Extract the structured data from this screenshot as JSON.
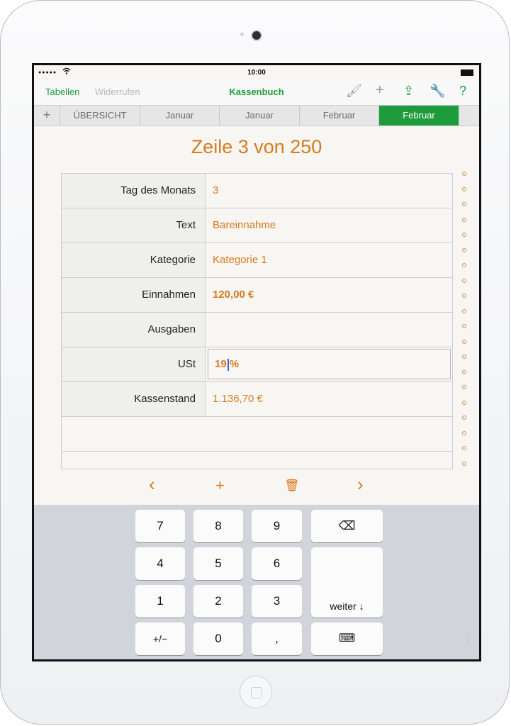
{
  "status_bar": {
    "signal": "●●●●●",
    "time": "10:00"
  },
  "toolbar": {
    "left_label": "Tabellen",
    "undo_label": "Widerrufen",
    "title": "Kassenbuch",
    "icons": [
      "format-brush-icon",
      "add-icon",
      "share-icon",
      "wrench-icon",
      "help-icon"
    ],
    "icon_glyphs": [
      "🖌",
      "+",
      "⇪",
      "🔧",
      "?"
    ]
  },
  "tabs": {
    "add_glyph": "+",
    "items": [
      {
        "label": "ÜBERSICHT",
        "active": false
      },
      {
        "label": "Januar",
        "active": false
      },
      {
        "label": "Januar",
        "active": false
      },
      {
        "label": "Februar",
        "active": false
      },
      {
        "label": "Februar",
        "active": true
      }
    ]
  },
  "form": {
    "title": "Zeile 3 von 250",
    "rows": [
      {
        "label": "Tag des Monats",
        "value": "3"
      },
      {
        "label": "Text",
        "value": "Bareinnahme"
      },
      {
        "label": "Kategorie",
        "value": "Kategorie 1"
      },
      {
        "label": "Einnahmen",
        "value": "120,00 €"
      },
      {
        "label": "Ausgaben",
        "value": ""
      },
      {
        "label": "USt",
        "value_before_caret": "19",
        "value_after_caret": "%"
      },
      {
        "label": "Kassenstand",
        "value": "1.136,70 €"
      }
    ]
  },
  "actions": {
    "prev": "‹",
    "add": "+",
    "delete": "🗑",
    "next": "›"
  },
  "keyboard": {
    "keys": [
      "7",
      "8",
      "9",
      "4",
      "5",
      "6",
      "1",
      "2",
      "3",
      "+/−",
      "0",
      ","
    ],
    "backspace": "⌫",
    "next_label": "weiter ↓",
    "hide": "⌨"
  },
  "colors": {
    "accent_green": "#1e9c3c",
    "accent_orange": "#d87a1e"
  }
}
